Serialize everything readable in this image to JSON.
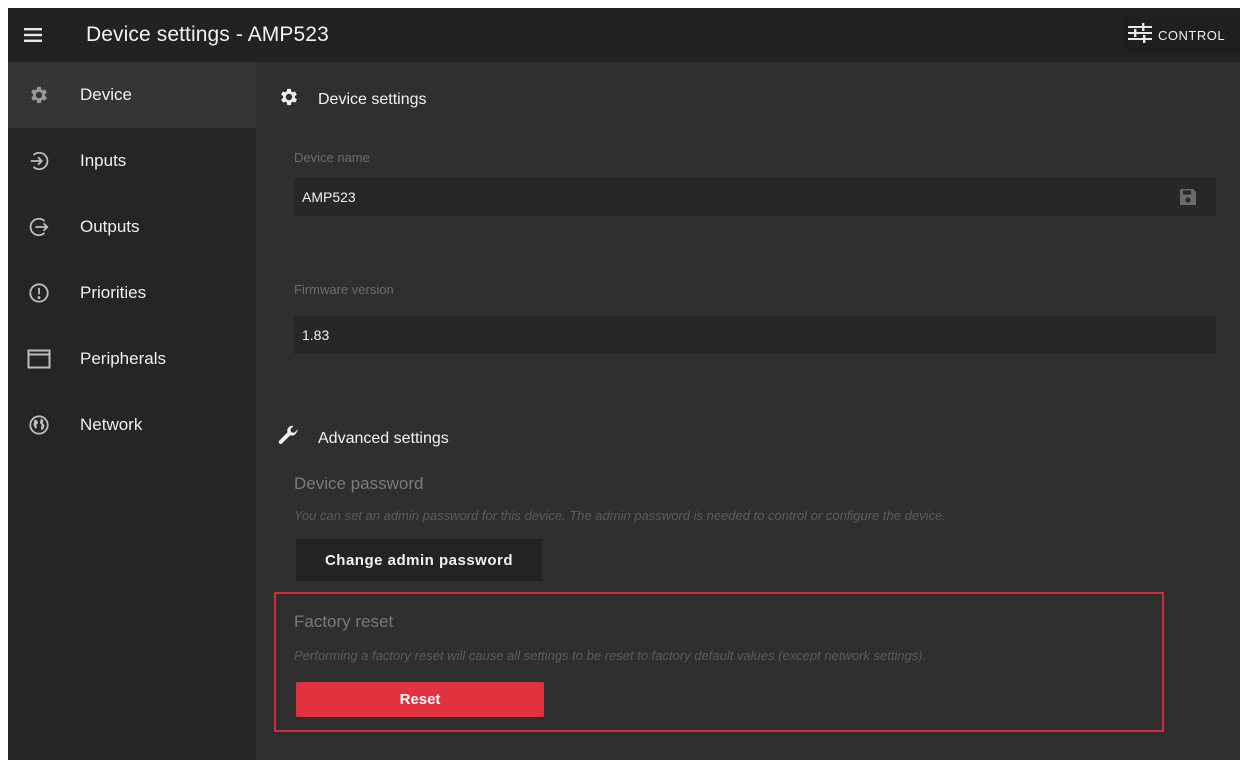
{
  "header": {
    "title": "Device settings - AMP523",
    "menu_icon": "hamburger-menu-icon",
    "control": {
      "label": "CONTROL",
      "icon": "sliders-icon"
    }
  },
  "sidebar": {
    "items": [
      {
        "label": "Device",
        "icon": "gear-icon",
        "active": true
      },
      {
        "label": "Inputs",
        "icon": "input-arrow-icon",
        "active": false
      },
      {
        "label": "Outputs",
        "icon": "output-arrow-icon",
        "active": false
      },
      {
        "label": "Priorities",
        "icon": "alert-circle-icon",
        "active": false
      },
      {
        "label": "Peripherals",
        "icon": "window-icon",
        "active": false
      },
      {
        "label": "Network",
        "icon": "globe-icon",
        "active": false
      }
    ]
  },
  "device_settings": {
    "title": "Device settings",
    "device_name": {
      "label": "Device name",
      "value": "AMP523",
      "save_icon": "floppy-disk-icon"
    },
    "firmware": {
      "label": "Firmware version",
      "value": "1.83"
    }
  },
  "advanced_settings": {
    "title": "Advanced settings",
    "password": {
      "title": "Device password",
      "description": "You can set an admin password for this device. The admin password is needed to control or configure the device.",
      "button": "Change admin password"
    },
    "factory_reset": {
      "title": "Factory reset",
      "description": "Performing a factory reset will cause all settings to be reset to factory default values (except network settings).",
      "button": "Reset"
    }
  },
  "colors": {
    "accent_red": "#e3323f",
    "highlight_border": "#d42a3a",
    "topbar": "#222222",
    "sidebar": "#252525",
    "content": "#2f2f2f"
  }
}
